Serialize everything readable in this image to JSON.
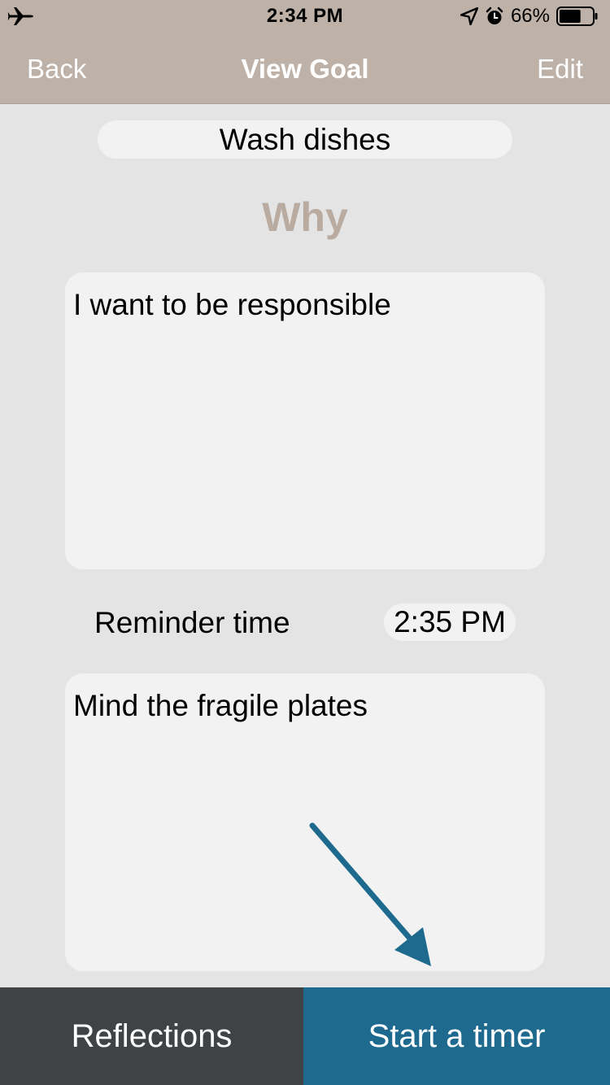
{
  "status_bar": {
    "time": "2:34 PM",
    "battery": "66%",
    "battery_level": 0.66,
    "icons": [
      "airplane-icon",
      "location-arrow-icon",
      "alarm-icon",
      "battery-icon"
    ]
  },
  "nav": {
    "back": "Back",
    "title": "View Goal",
    "edit": "Edit"
  },
  "goal": {
    "name": "Wash dishes",
    "why_label": "Why",
    "why_text": "I want to be responsible",
    "reminder_label": "Reminder time",
    "reminder_time": "2:35 PM",
    "notes": "Mind the fragile plates"
  },
  "tabs": {
    "reflections": "Reflections",
    "start_timer": "Start a timer"
  },
  "colors": {
    "nav_bg": "#bdb1a8",
    "why_label": "#b9aba0",
    "page_bg": "#e4e4e4",
    "field_bg": "#f2f2f2",
    "reflections_bg": "#404346",
    "timer_bg": "#1e6a8f",
    "annotation_arrow": "#1e6a8f"
  }
}
